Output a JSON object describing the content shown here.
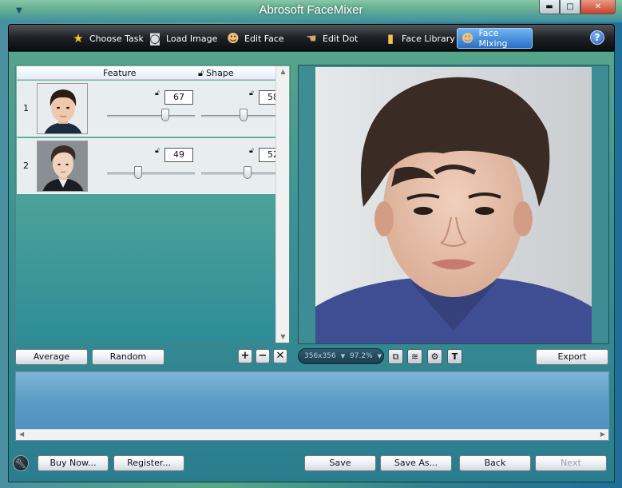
{
  "window": {
    "title": "Abrosoft FaceMixer",
    "minimize": "▬",
    "maximize": "□",
    "close": "✕"
  },
  "toolbar": {
    "items": [
      {
        "label": "Choose Task",
        "icon": "star-icon"
      },
      {
        "label": "Load Image",
        "icon": "camera-icon"
      },
      {
        "label": "Edit Face",
        "icon": "people-icon"
      },
      {
        "label": "Edit Dot",
        "icon": "pointing-hand-icon"
      },
      {
        "label": "Face Library",
        "icon": "folder-icon"
      },
      {
        "label": "Face Mixing",
        "icon": "people-icon"
      }
    ],
    "active": "Face Mixing",
    "help": "?"
  },
  "mix_list": {
    "headers": {
      "feature": "Feature",
      "shape": "Shape"
    },
    "rows": [
      {
        "index": "1",
        "feature": "67",
        "shape": "58"
      },
      {
        "index": "2",
        "feature": "49",
        "shape": "52"
      }
    ]
  },
  "buttons": {
    "average": "Average",
    "random": "Random",
    "add": "+",
    "remove": "−",
    "delete": "✕",
    "export": "Export",
    "buy_now": "Buy Now...",
    "register": "Register...",
    "save": "Save",
    "save_as": "Save As...",
    "back": "Back",
    "next": "Next"
  },
  "preview": {
    "size": "356x356",
    "zoom": "97.2%"
  },
  "colors": {
    "toolbar_active": "#3a86d8",
    "panel_bg": "#e8eef0"
  }
}
